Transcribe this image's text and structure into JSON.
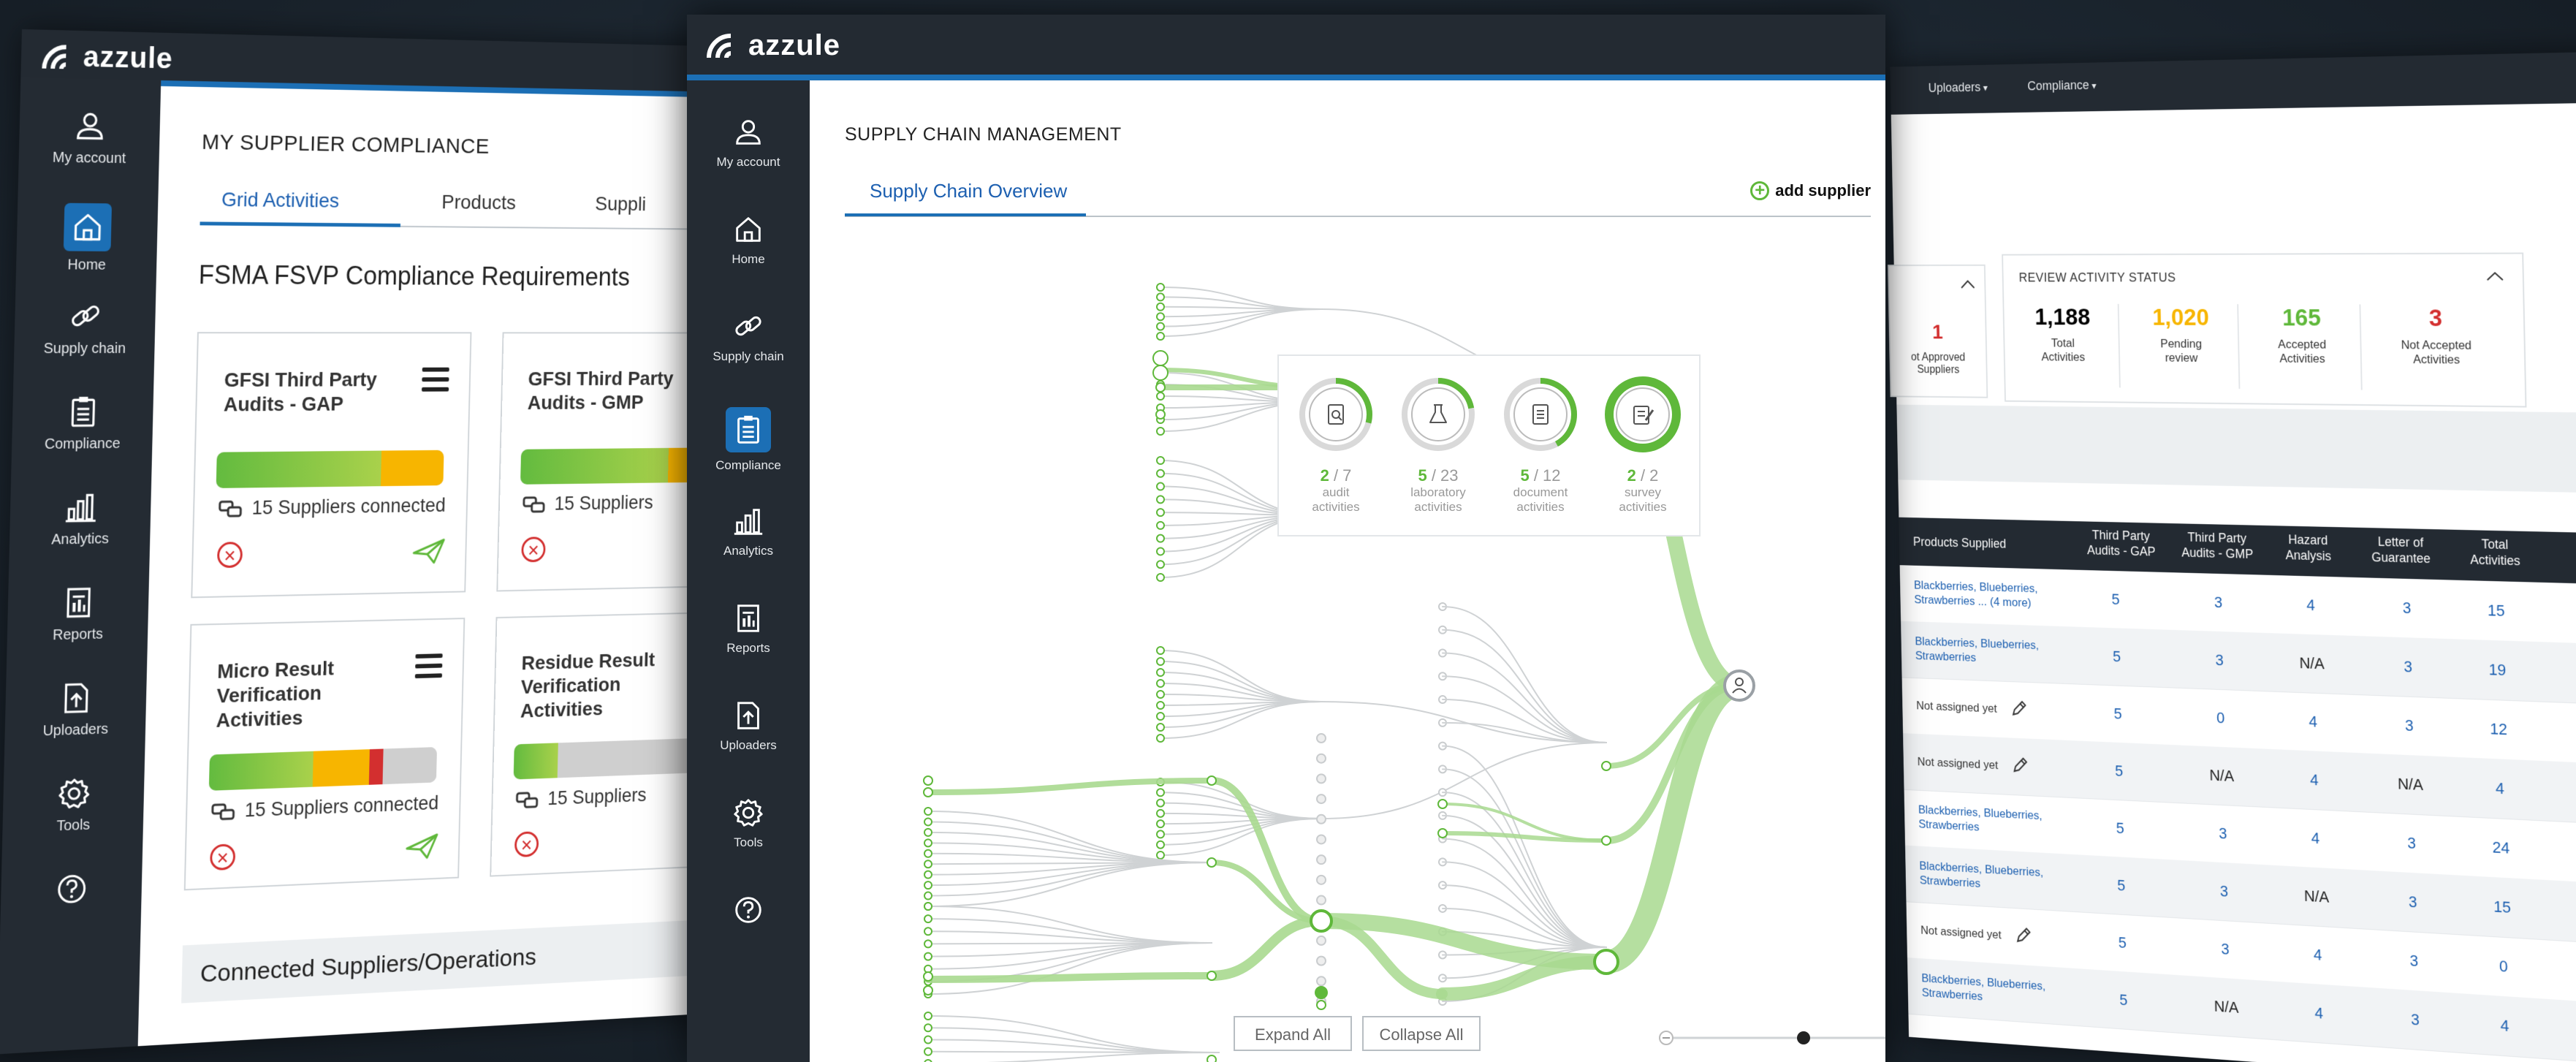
{
  "brand": "azzule",
  "colors": {
    "accent_blue": "#1c6fb5",
    "green": "#5fb83a",
    "yellow": "#f7b500",
    "red": "#d32f2f",
    "dark": "#242b33"
  },
  "nav": [
    {
      "label": "My account",
      "icon": "user-icon"
    },
    {
      "label": "Home",
      "icon": "home-icon"
    },
    {
      "label": "Supply chain",
      "icon": "link-icon"
    },
    {
      "label": "Compliance",
      "icon": "clipboard-icon"
    },
    {
      "label": "Analytics",
      "icon": "bar-chart-icon"
    },
    {
      "label": "Reports",
      "icon": "report-icon"
    },
    {
      "label": "Uploaders",
      "icon": "upload-icon"
    },
    {
      "label": "Tools",
      "icon": "gear-icon"
    },
    {
      "label": "",
      "icon": "help-icon"
    }
  ],
  "left": {
    "title": "MY SUPPLIER COMPLIANCE",
    "tabs": [
      "Grid Activities",
      "Products",
      "Suppli"
    ],
    "section": "FSMA FSVP Compliance Requirements",
    "cards": [
      {
        "title": "GFSI Third Party Audits - GAP",
        "suppliers": "15 Suppliers connected"
      },
      {
        "title": "GFSI Third Party Audits - GMP",
        "suppliers": "15 Suppliers"
      },
      {
        "title": "Micro Result Verification Activities",
        "suppliers": "15 Suppliers connected"
      },
      {
        "title": "Residue Result Verification Activities",
        "suppliers": "15 Suppliers"
      }
    ],
    "connected": "Connected Suppliers/Operations"
  },
  "center": {
    "title": "SUPPLY CHAIN MANAGEMENT",
    "tab": "Supply Chain Overview",
    "add_supplier": "add supplier",
    "activities": [
      {
        "label": "audit\nactivities",
        "done": "2",
        "total": "7",
        "icon": "audit-search-icon",
        "fraction": 0.29
      },
      {
        "label": "laboratory\nactivities",
        "done": "5",
        "total": "23",
        "icon": "flask-icon",
        "fraction": 0.22
      },
      {
        "label": "document\nactivities",
        "done": "5",
        "total": "12",
        "icon": "document-icon",
        "fraction": 0.42
      },
      {
        "label": "survey\nactivities",
        "done": "2",
        "total": "2",
        "icon": "survey-icon",
        "fraction": 1.0
      }
    ],
    "expand": "Expand All",
    "collapse": "Collapse All",
    "zoom_level": 0.5
  },
  "right": {
    "menus": [
      "Uploaders",
      "Compliance"
    ],
    "small_box": {
      "value": "1",
      "label": "ot Approved\nSuppliers"
    },
    "review_title": "REVIEW ACTIVITY STATUS",
    "stats": [
      {
        "value": "1,188",
        "label": "Total\nActivities",
        "color": "#222"
      },
      {
        "value": "1,020",
        "label": "Pending\nreview",
        "color": "#f7b500"
      },
      {
        "value": "165",
        "label": "Accepted\nActivities",
        "color": "#5fb83a"
      },
      {
        "value": "3",
        "label": "Not Accepted\nActivities",
        "color": "#d32f2f"
      }
    ],
    "columns": [
      "Products Supplied",
      "Third Party\nAudits - GAP",
      "Third Party\nAudits - GMP",
      "Hazard\nAnalysis",
      "Letter of\nGuarantee",
      "Total\nActivities"
    ],
    "rows": [
      {
        "product": "Blackberries, Blueberries,\nStrawberries ... (4 more)",
        "assigned": true,
        "gap": "5",
        "gmp": "3",
        "hazard": "4",
        "letter": "3",
        "total": "15"
      },
      {
        "product": "Blackberries, Blueberries,\nStrawberries",
        "assigned": true,
        "gap": "5",
        "gmp": "3",
        "hazard": "N/A",
        "letter": "3",
        "total": "19"
      },
      {
        "product": "Not assigned yet",
        "assigned": false,
        "gap": "5",
        "gmp": "0",
        "hazard": "4",
        "letter": "3",
        "total": "12"
      },
      {
        "product": "Not assigned yet",
        "assigned": false,
        "gap": "5",
        "gmp": "N/A",
        "hazard": "4",
        "letter": "N/A",
        "total": "4"
      },
      {
        "product": "Blackberries, Blueberries,\nStrawberries",
        "assigned": true,
        "gap": "5",
        "gmp": "3",
        "hazard": "4",
        "letter": "3",
        "total": "24"
      },
      {
        "product": "Blackberries, Blueberries,\nStrawberries",
        "assigned": true,
        "gap": "5",
        "gmp": "3",
        "hazard": "N/A",
        "letter": "3",
        "total": "15"
      },
      {
        "product": "Not assigned yet",
        "assigned": false,
        "gap": "5",
        "gmp": "3",
        "hazard": "4",
        "letter": "3",
        "total": "0"
      },
      {
        "product": "Blackberries, Blueberries,\nStrawberries",
        "assigned": true,
        "gap": "5",
        "gmp": "N/A",
        "hazard": "4",
        "letter": "3",
        "total": "4"
      }
    ]
  }
}
